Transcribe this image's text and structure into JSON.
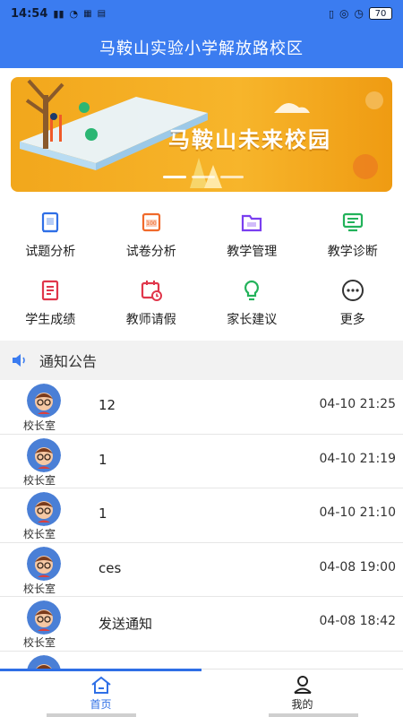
{
  "status_bar": {
    "time": "14:54",
    "left_icons": [
      "signal-icon",
      "wifi-icon",
      "data-speed-icon",
      "app-notify-icon"
    ],
    "right_icons": [
      "vibrate-icon",
      "alarm-icon",
      "clock-icon"
    ],
    "battery": "70"
  },
  "header": {
    "title": "马鞍山实验小学解放路校区"
  },
  "banner": {
    "text": "马鞍山未来校园",
    "slide_count": 3,
    "active_slide": 0
  },
  "menu": [
    {
      "label": "试题分析",
      "icon": "book-icon",
      "color": "#2f6fe6"
    },
    {
      "label": "试卷分析",
      "icon": "exam-paper-icon",
      "color": "#f06a2b"
    },
    {
      "label": "教学管理",
      "icon": "folder-icon",
      "color": "#7a3ff0"
    },
    {
      "label": "教学诊断",
      "icon": "monitor-icon",
      "color": "#22b25a"
    },
    {
      "label": "学生成绩",
      "icon": "report-icon",
      "color": "#e0364b"
    },
    {
      "label": "教师请假",
      "icon": "calendar-icon",
      "color": "#e0364b"
    },
    {
      "label": "家长建议",
      "icon": "lightbulb-icon",
      "color": "#22b25a"
    },
    {
      "label": "更多",
      "icon": "more-icon",
      "color": "#333333"
    }
  ],
  "notices": {
    "header_label": "通知公告",
    "items": [
      {
        "sender": "校长室",
        "title": "12",
        "time": "04-10 21:25"
      },
      {
        "sender": "校长室",
        "title": "1",
        "time": "04-10 21:19"
      },
      {
        "sender": "校长室",
        "title": "1",
        "time": "04-10 21:10"
      },
      {
        "sender": "校长室",
        "title": "ces",
        "time": "04-08 19:00"
      },
      {
        "sender": "校长室",
        "title": "发送通知",
        "time": "04-08 18:42"
      }
    ]
  },
  "tabbar": {
    "tabs": [
      {
        "label": "首页",
        "icon": "home-icon",
        "active": true
      },
      {
        "label": "我的",
        "icon": "user-icon",
        "active": false
      }
    ]
  }
}
